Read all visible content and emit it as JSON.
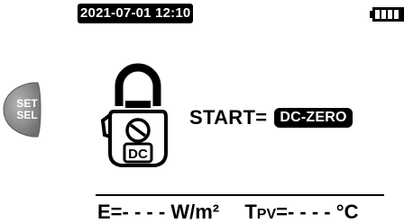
{
  "set_button": {
    "line1": "SET",
    "line2": "SEL"
  },
  "header": {
    "datetime": "2021-07-01 12:10",
    "battery_icon": "battery-full-icon"
  },
  "main": {
    "mode_icon": "clamp-meter-dc-icon",
    "mode_icon_label": "DC",
    "start_label": "START=",
    "start_value": "DC-ZERO"
  },
  "status": {
    "e_label": "E=",
    "e_value": "- - - -",
    "e_unit": "W/m²",
    "tpv_t": "T",
    "tpv_sub": "PV",
    "tpv_eq": "=",
    "tpv_value": "- - - -",
    "tpv_unit": "°C"
  },
  "colors": {
    "screen_bg": "#ffffff",
    "ink": "#000000",
    "button_gray": "#8a8a8a"
  }
}
